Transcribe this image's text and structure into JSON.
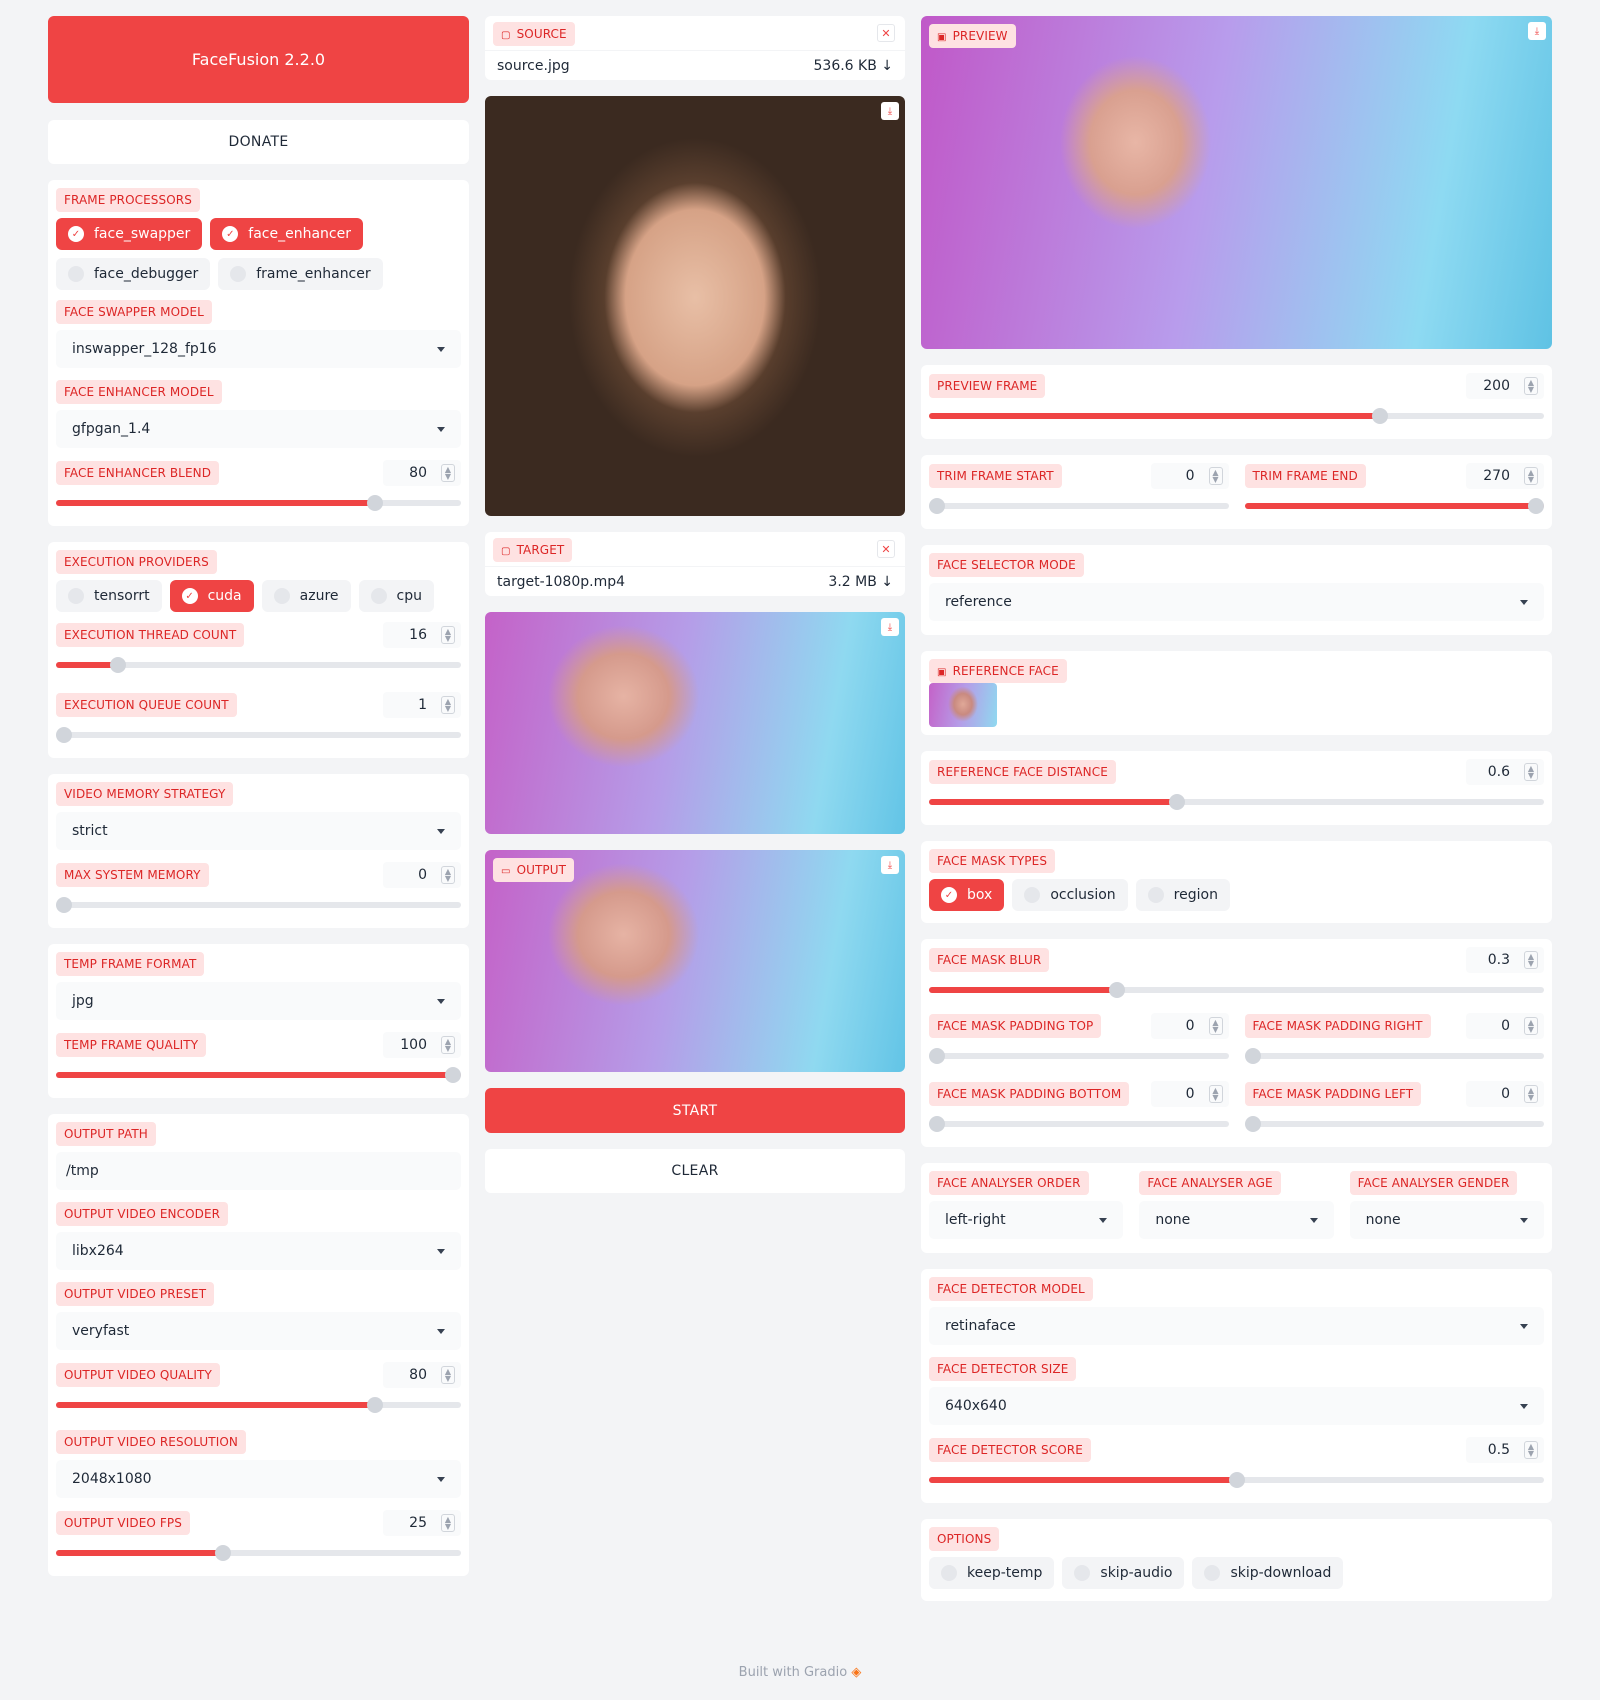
{
  "app": {
    "title": "FaceFusion 2.2.0",
    "donate": "DONATE",
    "start": "START",
    "clear": "CLEAR",
    "footer": "Built with Gradio",
    "accent": "#ef4444"
  },
  "left": {
    "frame_processors": {
      "label": "FRAME PROCESSORS",
      "items": [
        {
          "name": "face_swapper",
          "checked": true
        },
        {
          "name": "face_enhancer",
          "checked": true
        },
        {
          "name": "face_debugger",
          "checked": false
        },
        {
          "name": "frame_enhancer",
          "checked": false
        }
      ]
    },
    "face_swapper_model": {
      "label": "FACE SWAPPER MODEL",
      "value": "inswapper_128_fp16"
    },
    "face_enhancer_model": {
      "label": "FACE ENHANCER MODEL",
      "value": "gfpgan_1.4"
    },
    "face_enhancer_blend": {
      "label": "FACE ENHANCER BLEND",
      "value": "80",
      "fraction": 0.8
    },
    "execution_providers": {
      "label": "EXECUTION PROVIDERS",
      "items": [
        {
          "name": "tensorrt",
          "checked": false
        },
        {
          "name": "cuda",
          "checked": true
        },
        {
          "name": "azure",
          "checked": false
        },
        {
          "name": "cpu",
          "checked": false
        }
      ]
    },
    "execution_thread_count": {
      "label": "EXECUTION THREAD COUNT",
      "value": "16",
      "fraction": 0.14
    },
    "execution_queue_count": {
      "label": "EXECUTION QUEUE COUNT",
      "value": "1",
      "fraction": 0.0
    },
    "video_memory_strategy": {
      "label": "VIDEO MEMORY STRATEGY",
      "value": "strict"
    },
    "max_system_memory": {
      "label": "MAX SYSTEM MEMORY",
      "value": "0",
      "fraction": 0.0
    },
    "temp_frame_format": {
      "label": "TEMP FRAME FORMAT",
      "value": "jpg"
    },
    "temp_frame_quality": {
      "label": "TEMP FRAME QUALITY",
      "value": "100",
      "fraction": 1.0
    },
    "output_path": {
      "label": "OUTPUT PATH",
      "value": "/tmp"
    },
    "output_video_encoder": {
      "label": "OUTPUT VIDEO ENCODER",
      "value": "libx264"
    },
    "output_video_preset": {
      "label": "OUTPUT VIDEO PRESET",
      "value": "veryfast"
    },
    "output_video_quality": {
      "label": "OUTPUT VIDEO QUALITY",
      "value": "80",
      "fraction": 0.8
    },
    "output_video_resolution": {
      "label": "OUTPUT VIDEO RESOLUTION",
      "value": "2048x1080"
    },
    "output_video_fps": {
      "label": "OUTPUT VIDEO FPS",
      "value": "25",
      "fraction": 0.41
    }
  },
  "middle": {
    "source": {
      "label": "SOURCE",
      "filename": "source.jpg",
      "size": "536.6 KB ↓"
    },
    "target": {
      "label": "TARGET",
      "filename": "target-1080p.mp4",
      "size": "3.2 MB ↓"
    },
    "output": {
      "label": "OUTPUT"
    }
  },
  "right": {
    "preview": {
      "label": "PREVIEW"
    },
    "preview_frame": {
      "label": "PREVIEW FRAME",
      "value": "200",
      "fraction": 0.74
    },
    "trim_frame_start": {
      "label": "TRIM FRAME START",
      "value": "0",
      "fraction": 0.0
    },
    "trim_frame_end": {
      "label": "TRIM FRAME END",
      "value": "270",
      "fraction": 1.0
    },
    "face_selector_mode": {
      "label": "FACE SELECTOR MODE",
      "value": "reference"
    },
    "reference_face": {
      "label": "REFERENCE FACE"
    },
    "reference_face_distance": {
      "label": "REFERENCE FACE DISTANCE",
      "value": "0.6",
      "fraction": 0.4
    },
    "face_mask_types": {
      "label": "FACE MASK TYPES",
      "items": [
        {
          "name": "box",
          "checked": true
        },
        {
          "name": "occlusion",
          "checked": false
        },
        {
          "name": "region",
          "checked": false
        }
      ]
    },
    "face_mask_blur": {
      "label": "FACE MASK BLUR",
      "value": "0.3",
      "fraction": 0.3
    },
    "face_mask_padding_top": {
      "label": "FACE MASK PADDING TOP",
      "value": "0",
      "fraction": 0.0
    },
    "face_mask_padding_right": {
      "label": "FACE MASK PADDING RIGHT",
      "value": "0",
      "fraction": 0.0
    },
    "face_mask_padding_bottom": {
      "label": "FACE MASK PADDING BOTTOM",
      "value": "0",
      "fraction": 0.0
    },
    "face_mask_padding_left": {
      "label": "FACE MASK PADDING LEFT",
      "value": "0",
      "fraction": 0.0
    },
    "face_analyser_order": {
      "label": "FACE ANALYSER ORDER",
      "value": "left-right"
    },
    "face_analyser_age": {
      "label": "FACE ANALYSER AGE",
      "value": "none"
    },
    "face_analyser_gender": {
      "label": "FACE ANALYSER GENDER",
      "value": "none"
    },
    "face_detector_model": {
      "label": "FACE DETECTOR MODEL",
      "value": "retinaface"
    },
    "face_detector_size": {
      "label": "FACE DETECTOR SIZE",
      "value": "640x640"
    },
    "face_detector_score": {
      "label": "FACE DETECTOR SCORE",
      "value": "0.5",
      "fraction": 0.5
    },
    "options": {
      "label": "OPTIONS",
      "items": [
        {
          "name": "keep-temp",
          "checked": false
        },
        {
          "name": "skip-audio",
          "checked": false
        },
        {
          "name": "skip-download",
          "checked": false
        }
      ]
    }
  }
}
